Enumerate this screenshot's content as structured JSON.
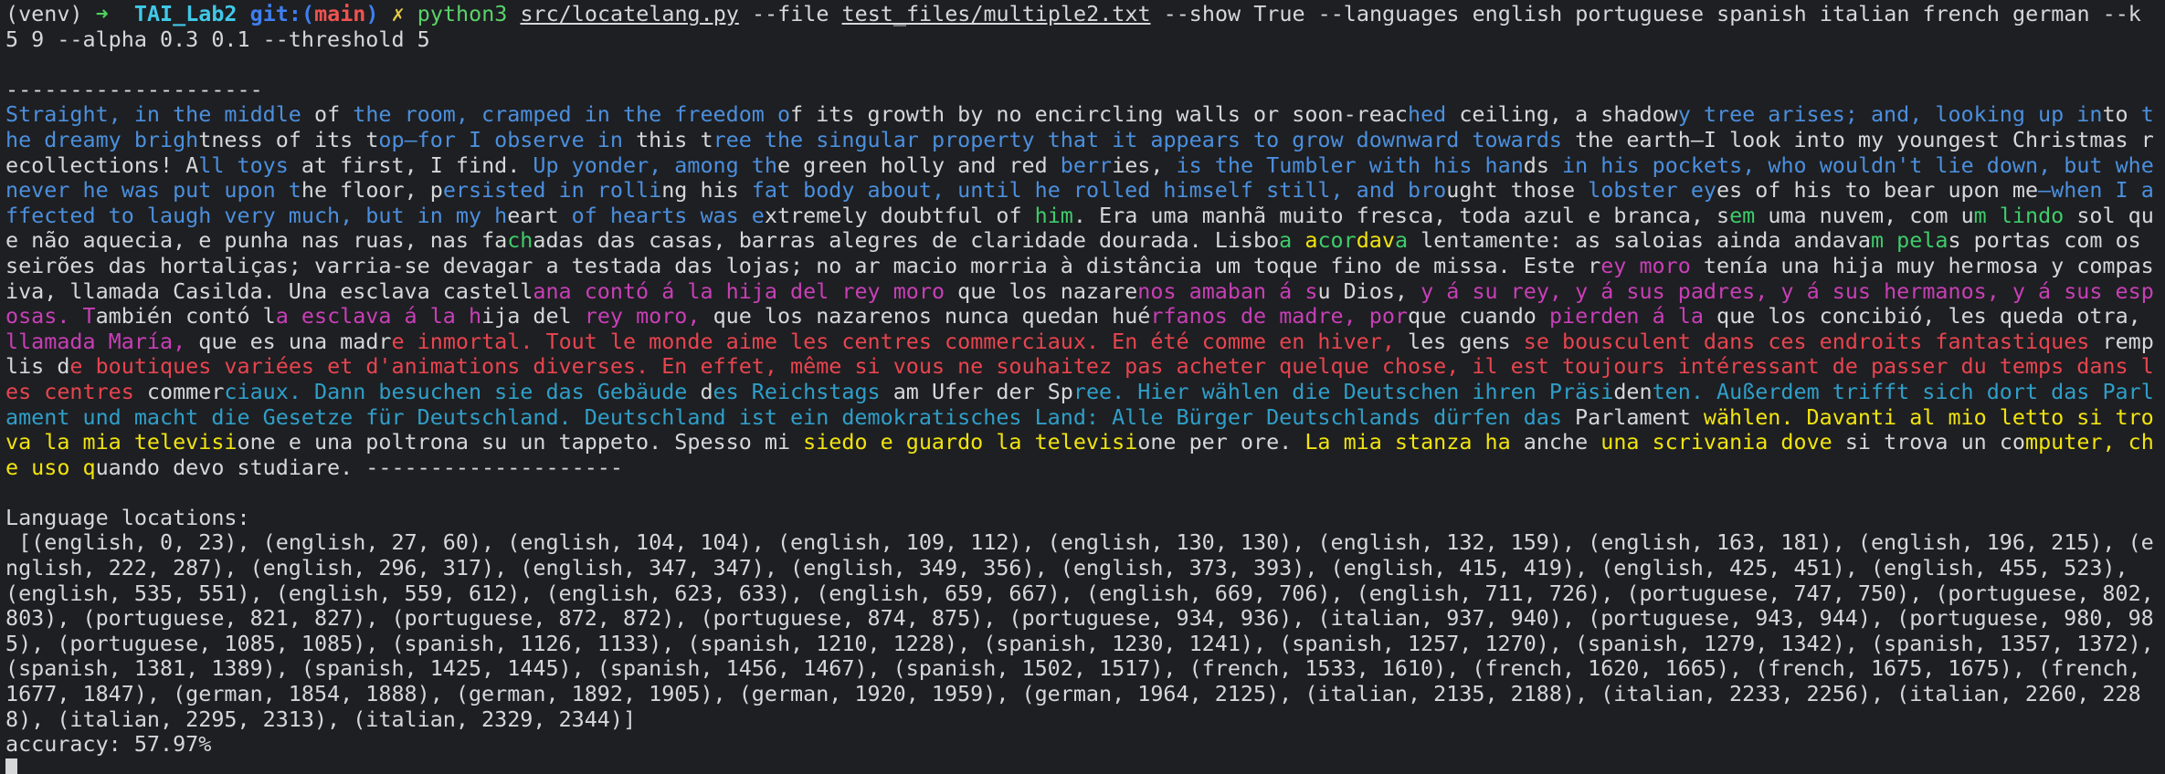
{
  "prompt": {
    "venv": "(venv)",
    "arrow": "➜",
    "dir": "TAI_Lab2",
    "git_label": "git:",
    "branch_open": "(",
    "branch": "main",
    "branch_close": ")",
    "dirty": "✗",
    "cmd_name": "python3",
    "script_path": "src/locatelang.py",
    "arg_file_flag": "--file",
    "file_path": "test_files/multiple2.txt",
    "args_rest": "--show True --languages english portuguese spanish italian french german --k 5 9 --alpha 0.3 0.1 --threshold 5"
  },
  "separator": "--------------------",
  "colored_text": [
    {
      "lang": "english",
      "t": "Straight, in the middle "
    },
    {
      "lang": "none",
      "t": "of "
    },
    {
      "lang": "english",
      "t": "the room, cramped in the freedom o"
    },
    {
      "lang": "none",
      "t": "f its growth by no encircling walls or soon-reac"
    },
    {
      "lang": "english",
      "t": "hed"
    },
    {
      "lang": "none",
      "t": " ceiling, a shadow"
    },
    {
      "lang": "english",
      "t": "y tree arises; and, looking up in"
    },
    {
      "lang": "none",
      "t": "to"
    },
    {
      "lang": "english",
      "t": " the dreamy brigh"
    },
    {
      "lang": "none",
      "t": "tness of its t"
    },
    {
      "lang": "english",
      "t": "op—for I observe in "
    },
    {
      "lang": "none",
      "t": "this t"
    },
    {
      "lang": "english",
      "t": "ree the singular property that it appears to grow downward towards "
    },
    {
      "lang": "none",
      "t": "the earth—I look into my youn"
    },
    {
      "lang": "none",
      "t": "gest Christmas recollections! A"
    },
    {
      "lang": "english",
      "t": "ll toys "
    },
    {
      "lang": "none",
      "t": "at first, I find. "
    },
    {
      "lang": "english",
      "t": "Up yonder, among th"
    },
    {
      "lang": "none",
      "t": "e green holly and red "
    },
    {
      "lang": "english",
      "t": "berr"
    },
    {
      "lang": "none",
      "t": "ies, "
    },
    {
      "lang": "english",
      "t": "is the Tumbler with his han"
    },
    {
      "lang": "none",
      "t": "ds "
    },
    {
      "lang": "english",
      "t": "in his pockets, who wouldn't lie down, but whenever he was put upon t"
    },
    {
      "lang": "none",
      "t": "he floor, p"
    },
    {
      "lang": "english",
      "t": "ersisted in rolli"
    },
    {
      "lang": "none",
      "t": "ng his "
    },
    {
      "lang": "english",
      "t": "fat body about, until he rolled himself still, and bro"
    },
    {
      "lang": "none",
      "t": "ught those "
    },
    {
      "lang": "english",
      "t": "lobster ey"
    },
    {
      "lang": "none",
      "t": "es of his to bear upon me"
    },
    {
      "lang": "english",
      "t": "—when I affected to laugh very much, but in my h"
    },
    {
      "lang": "none",
      "t": "eart "
    },
    {
      "lang": "english",
      "t": "of hearts was e"
    },
    {
      "lang": "none",
      "t": "xtremely doubtful of "
    },
    {
      "lang": "portuguese",
      "t": "him"
    },
    {
      "lang": "none",
      "t": ". Era uma manhã muito fresca, toda azul e branca, s"
    },
    {
      "lang": "portuguese",
      "t": "em"
    },
    {
      "lang": "none",
      "t": " uma nuvem, com u"
    },
    {
      "lang": "portuguese",
      "t": "m lindo"
    },
    {
      "lang": "none",
      "t": " sol que não aquecia, e punha nas ruas, nas fa"
    },
    {
      "lang": "portuguese",
      "t": "ch"
    },
    {
      "lang": "none",
      "t": "adas das casas, barras alegres de claridade dourada. Lisbo"
    },
    {
      "lang": "portuguese",
      "t": "a "
    },
    {
      "lang": "italian",
      "t": "a"
    },
    {
      "lang": "portuguese",
      "t": "cor"
    },
    {
      "lang": "italian",
      "t": "dav"
    },
    {
      "lang": "portuguese",
      "t": "a"
    },
    {
      "lang": "none",
      "t": " lentamente: as saloias ainda andava"
    },
    {
      "lang": "portuguese",
      "t": "m pela"
    },
    {
      "lang": "none",
      "t": "s portas com os seirões das hortaliças; varria-se devagar a testada das lojas; no ar macio morria à distância um toque fino de missa. Este r"
    },
    {
      "lang": "spanish",
      "t": "ey moro"
    },
    {
      "lang": "none",
      "t": " tenía una hija muy hermosa y compasiva, llamada Casilda. Una esclava castell"
    },
    {
      "lang": "spanish",
      "t": "ana contó á la hija del rey moro"
    },
    {
      "lang": "none",
      "t": " que los nazare"
    },
    {
      "lang": "spanish",
      "t": "nos amaban á s"
    },
    {
      "lang": "none",
      "t": "u Dios, "
    },
    {
      "lang": "spanish",
      "t": "y á su rey, y á sus padres, y á sus hermanos, y á sus esposas. T"
    },
    {
      "lang": "none",
      "t": "ambién contó l"
    },
    {
      "lang": "spanish",
      "t": "a esclava á la h"
    },
    {
      "lang": "none",
      "t": "ija del "
    },
    {
      "lang": "spanish",
      "t": "rey moro, "
    },
    {
      "lang": "none",
      "t": "que los nazarenos nunca quedan hué"
    },
    {
      "lang": "spanish",
      "t": "rfanos de madre, por"
    },
    {
      "lang": "none",
      "t": "que cuando "
    },
    {
      "lang": "spanish",
      "t": "pierden á la"
    },
    {
      "lang": "none",
      "t": " que los concibió, les queda otra, "
    },
    {
      "lang": "spanish",
      "t": "llamada María, "
    },
    {
      "lang": "none",
      "t": "que es una madr"
    },
    {
      "lang": "french",
      "t": "e inmortal. Tout le monde aime les centres commerciaux. En été comme en hiver, "
    },
    {
      "lang": "none",
      "t": "les gens "
    },
    {
      "lang": "french",
      "t": "se bousculent dans ces endroits fantastiques "
    },
    {
      "lang": "none",
      "t": "remplis d"
    },
    {
      "lang": "french",
      "t": "e boutiques variées et d'animations diverses. En effet, même si vous ne souhaitez pas acheter quelque chose, il est toujours intéressant de passer du temps dans les centres "
    },
    {
      "lang": "none",
      "t": "commer"
    },
    {
      "lang": "german",
      "t": "ciaux. Dann besuchen sie das Gebäude"
    },
    {
      "lang": "none",
      "t": " d"
    },
    {
      "lang": "german",
      "t": "es Reichstags "
    },
    {
      "lang": "none",
      "t": "am Ufer der Sp"
    },
    {
      "lang": "german",
      "t": "ree. Hier wählen die Deutschen ihren Präsi"
    },
    {
      "lang": "none",
      "t": "den"
    },
    {
      "lang": "german",
      "t": "ten. Außerdem trifft sich dort das Parlament und macht die Gesetze für Deutschland. Deutschland ist ein demokratisches Land: Alle Bürger Deutschlands dürfen das "
    },
    {
      "lang": "none",
      "t": "Parlament "
    },
    {
      "lang": "italian",
      "t": "wählen. Davanti al mio letto si trova la mia televisi"
    },
    {
      "lang": "none",
      "t": "one e una poltrona su un tappeto. Spesso mi "
    },
    {
      "lang": "italian",
      "t": "siedo e guardo la televisi"
    },
    {
      "lang": "none",
      "t": "one per ore. "
    },
    {
      "lang": "italian",
      "t": "La mia stanza ha "
    },
    {
      "lang": "none",
      "t": "anche "
    },
    {
      "lang": "italian",
      "t": "una scrivania dove "
    },
    {
      "lang": "none",
      "t": "si trova un co"
    },
    {
      "lang": "italian",
      "t": "mputer, che uso q"
    },
    {
      "lang": "none",
      "t": "uando devo studiare. --------------------"
    }
  ],
  "locations_label": "Language locations:",
  "locations_text": " [(english, 0, 23), (english, 27, 60), (english, 104, 104), (english, 109, 112), (english, 130, 130), (english, 132, 159), (english, 163, 181), (english, 196, 215), (english, 222, 287), (english, 296, 317), (english, 347, 347), (english, 349, 356), (english, 373, 393), (english, 415, 419), (english, 425, 451), (english, 455, 523), (english, 535, 551), (english, 559, 612), (english, 623, 633), (english, 659, 667), (english, 669, 706), (english, 711, 726), (portuguese, 747, 750), (portuguese, 802, 803), (portuguese, 821, 827), (portuguese, 872, 872), (portuguese, 874, 875), (portuguese, 934, 936), (italian, 937, 940), (portuguese, 943, 944), (portuguese, 980, 985), (portuguese, 1085, 1085), (spanish, 1126, 1133), (spanish, 1210, 1228), (spanish, 1230, 1241), (spanish, 1257, 1270), (spanish, 1279, 1342), (spanish, 1357, 1372), (spanish, 1381, 1389), (spanish, 1425, 1445), (spanish, 1456, 1467), (spanish, 1502, 1517), (french, 1533, 1610), (french, 1620, 1665), (french, 1675, 1675), (french, 1677, 1847), (german, 1854, 1888), (german, 1892, 1905), (german, 1920, 1959), (german, 1964, 2125), (italian, 2135, 2188), (italian, 2233, 2256), (italian, 2260, 2288), (italian, 2295, 2313), (italian, 2329, 2344)]",
  "accuracy_label": "accuracy:",
  "accuracy_value": "57.97%",
  "colors": {
    "background": "#1e1f22",
    "default_text": "#d6d7d9",
    "english": "#4b8fde",
    "portuguese": "#3fcc6b",
    "spanish": "#c83fb7",
    "french": "#e8444f",
    "german": "#2f9fc9",
    "italian": "#f1e40f"
  }
}
